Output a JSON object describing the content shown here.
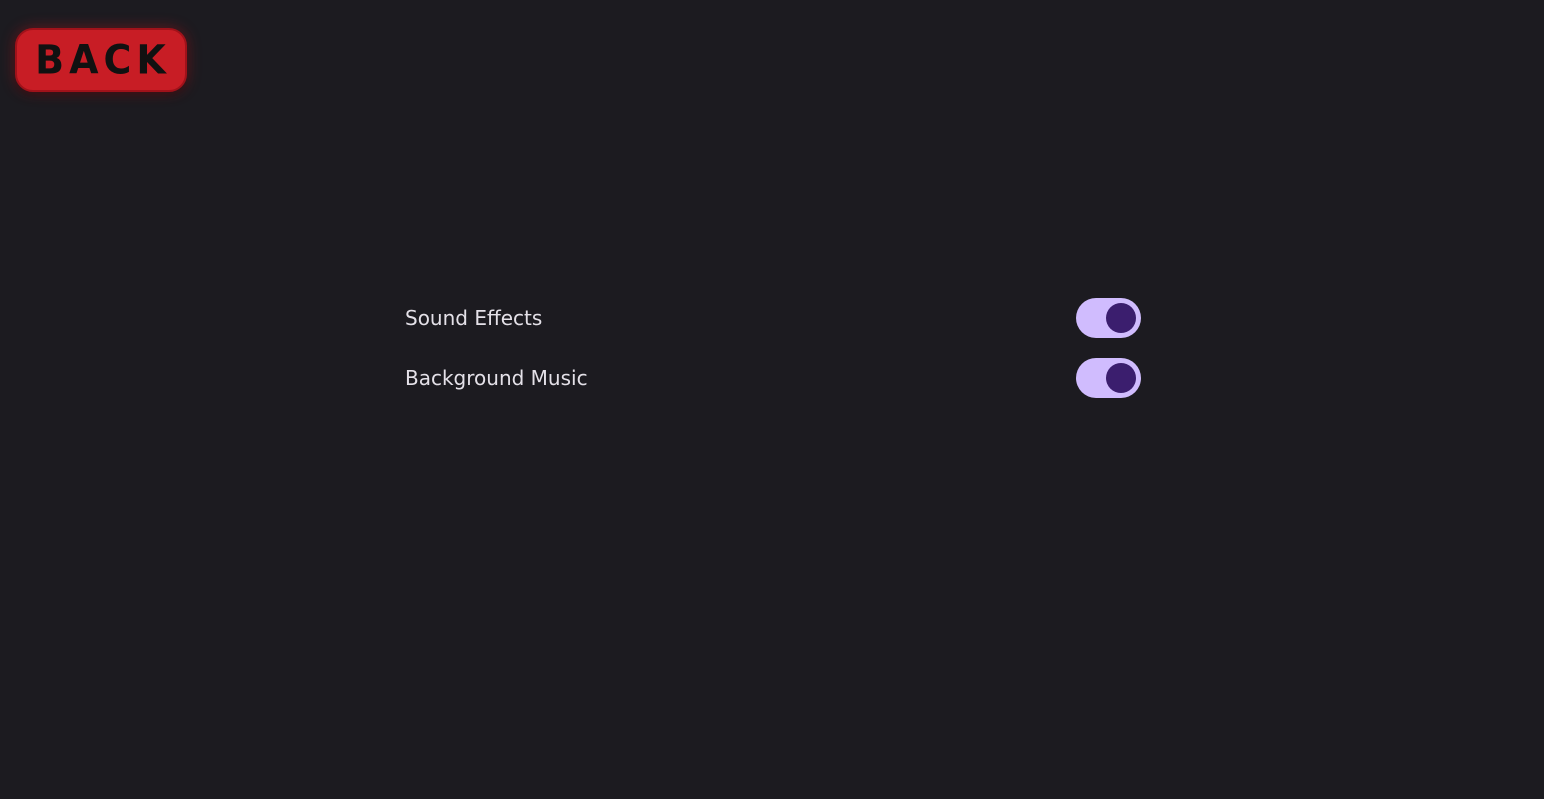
{
  "back_button": {
    "label": "BACK"
  },
  "settings": [
    {
      "label": "Sound Effects",
      "enabled": true
    },
    {
      "label": "Background Music",
      "enabled": true
    }
  ],
  "colors": {
    "background": "#1c1b20",
    "back_button": "#c81d25",
    "toggle_track": "#d0bcfe",
    "toggle_knob": "#3b1e6e"
  }
}
